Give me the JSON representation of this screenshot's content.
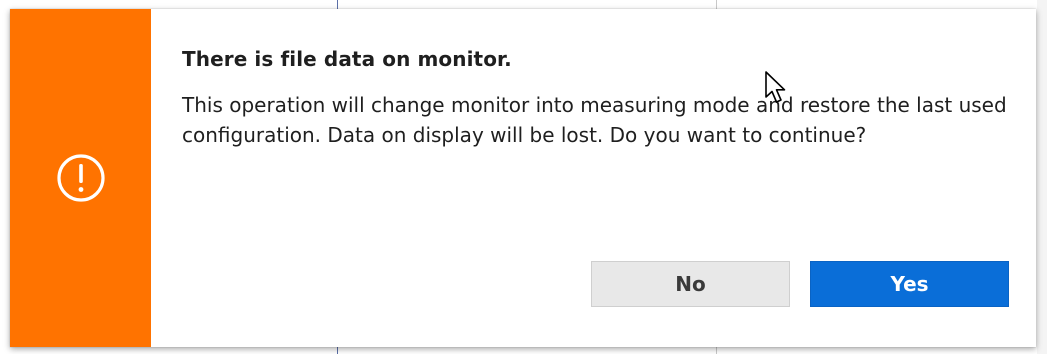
{
  "dialog": {
    "title": "There is file data on monitor.",
    "message": "This operation will change monitor into measuring mode and restore the last used configuration. Data on display will be lost. Do you want to continue?",
    "icon": "warning-exclamation-icon",
    "accent_color": "#ff7300",
    "buttons": {
      "no_label": "No",
      "yes_label": "Yes"
    },
    "primary_color": "#0a6ed8"
  }
}
